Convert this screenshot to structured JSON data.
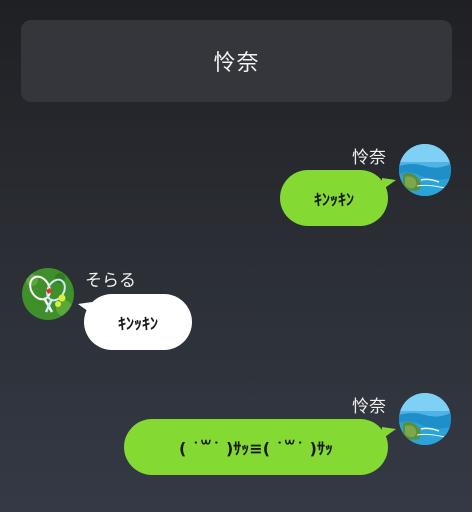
{
  "header": {
    "title": "怜奈"
  },
  "messages": [
    {
      "side": "right",
      "sender": "怜奈",
      "text": "ｷﾝｯｷﾝ",
      "avatar": "ocean-coast-avatar"
    },
    {
      "side": "left",
      "sender": "そらる",
      "text": "ｷﾝｯｷﾝ",
      "avatar": "tennis-rackets-avatar"
    },
    {
      "side": "right",
      "sender": "怜奈",
      "text": "( ˙꒳˙ )ｻｯ≡( ˙꒳˙ )ｻｯ",
      "avatar": "ocean-coast-avatar"
    }
  ],
  "colors": {
    "outgoing_bubble": "#84d932",
    "incoming_bubble": "#ffffff",
    "header_bg": "#34363b"
  }
}
